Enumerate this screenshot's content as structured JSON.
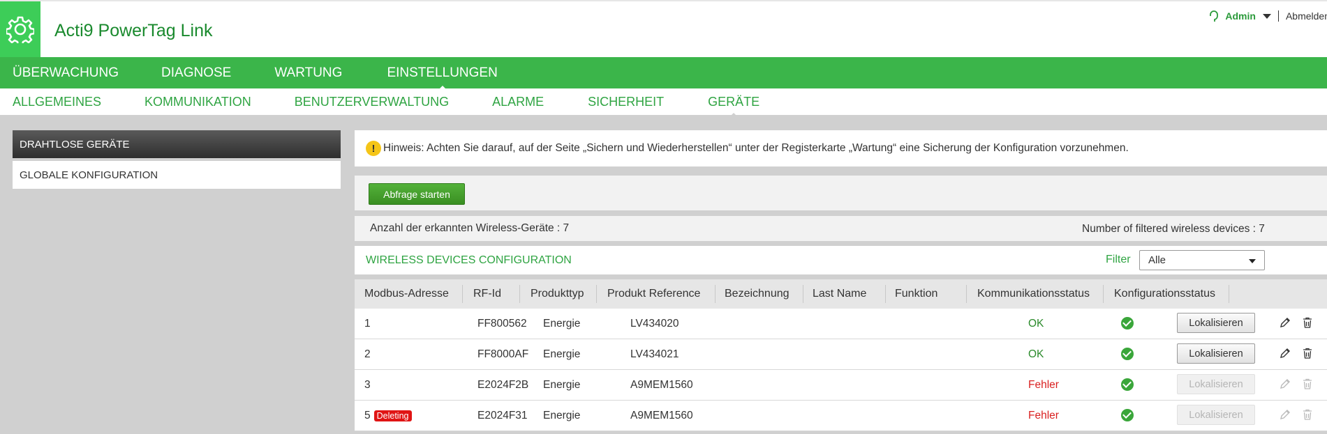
{
  "app": {
    "title": "Acti9 PowerTag Link"
  },
  "user": {
    "name": "Admin",
    "logout": "Abmelden"
  },
  "main_nav": [
    {
      "label": "ÜBERWACHUNG"
    },
    {
      "label": "DIAGNOSE"
    },
    {
      "label": "WARTUNG"
    },
    {
      "label": "EINSTELLUNGEN",
      "active": true
    }
  ],
  "sub_nav": [
    {
      "label": "ALLGEMEINES"
    },
    {
      "label": "KOMMUNIKATION"
    },
    {
      "label": "BENUTZERVERWALTUNG"
    },
    {
      "label": "ALARME"
    },
    {
      "label": "SICHERHEIT"
    },
    {
      "label": "GERÄTE",
      "active": true
    }
  ],
  "sidebar": {
    "items": [
      {
        "label": "DRAHTLOSE GERÄTE",
        "active": true
      },
      {
        "label": "GLOBALE KONFIGURATION"
      }
    ]
  },
  "hint": {
    "text": "Hinweis: Achten Sie darauf, auf der Seite „Sichern und Wiederherstellen“ unter der Registerkarte „Wartung“ eine Sicherung der Konfiguration vorzunehmen."
  },
  "scan_button": "Abfrage starten",
  "counts": {
    "detected": "Anzahl der erkannten Wireless-Geräte : 7",
    "filtered": "Number of filtered wireless devices : 7"
  },
  "config": {
    "title": "WIRELESS DEVICES CONFIGURATION",
    "filter_label": "Filter",
    "filter_value": "Alle"
  },
  "table": {
    "headers": [
      "Modbus-Adresse",
      "RF-Id",
      "Produkttyp",
      "Produkt Reference",
      "Bezeichnung",
      "Last Name",
      "Funktion",
      "Kommunikationsstatus",
      "Konfigurationsstatus"
    ],
    "rows": [
      {
        "modbus": "1",
        "badge": "",
        "rfid": "FF800562",
        "type": "Energie",
        "reference": "LV434020",
        "comm": "OK",
        "comm_status": "ok",
        "locate": "Lokalisieren",
        "locate_enabled": true
      },
      {
        "modbus": "2",
        "badge": "",
        "rfid": "FF8000AF",
        "type": "Energie",
        "reference": "LV434021",
        "comm": "OK",
        "comm_status": "ok",
        "locate": "Lokalisieren",
        "locate_enabled": true
      },
      {
        "modbus": "3",
        "badge": "",
        "rfid": "E2024F2B",
        "type": "Energie",
        "reference": "A9MEM1560",
        "comm": "Fehler",
        "comm_status": "error",
        "locate": "Lokalisieren",
        "locate_enabled": false
      },
      {
        "modbus": "5",
        "badge": "Deleting",
        "rfid": "E2024F31",
        "type": "Energie",
        "reference": "A9MEM1560",
        "comm": "Fehler",
        "comm_status": "error",
        "locate": "Lokalisieren",
        "locate_enabled": false
      }
    ]
  },
  "colors": {
    "brand_green": "#3dcd58",
    "nav_green": "#3bb54a",
    "text_green": "#2fa442",
    "error_red": "#d92020",
    "badge_red": "#e01414"
  }
}
